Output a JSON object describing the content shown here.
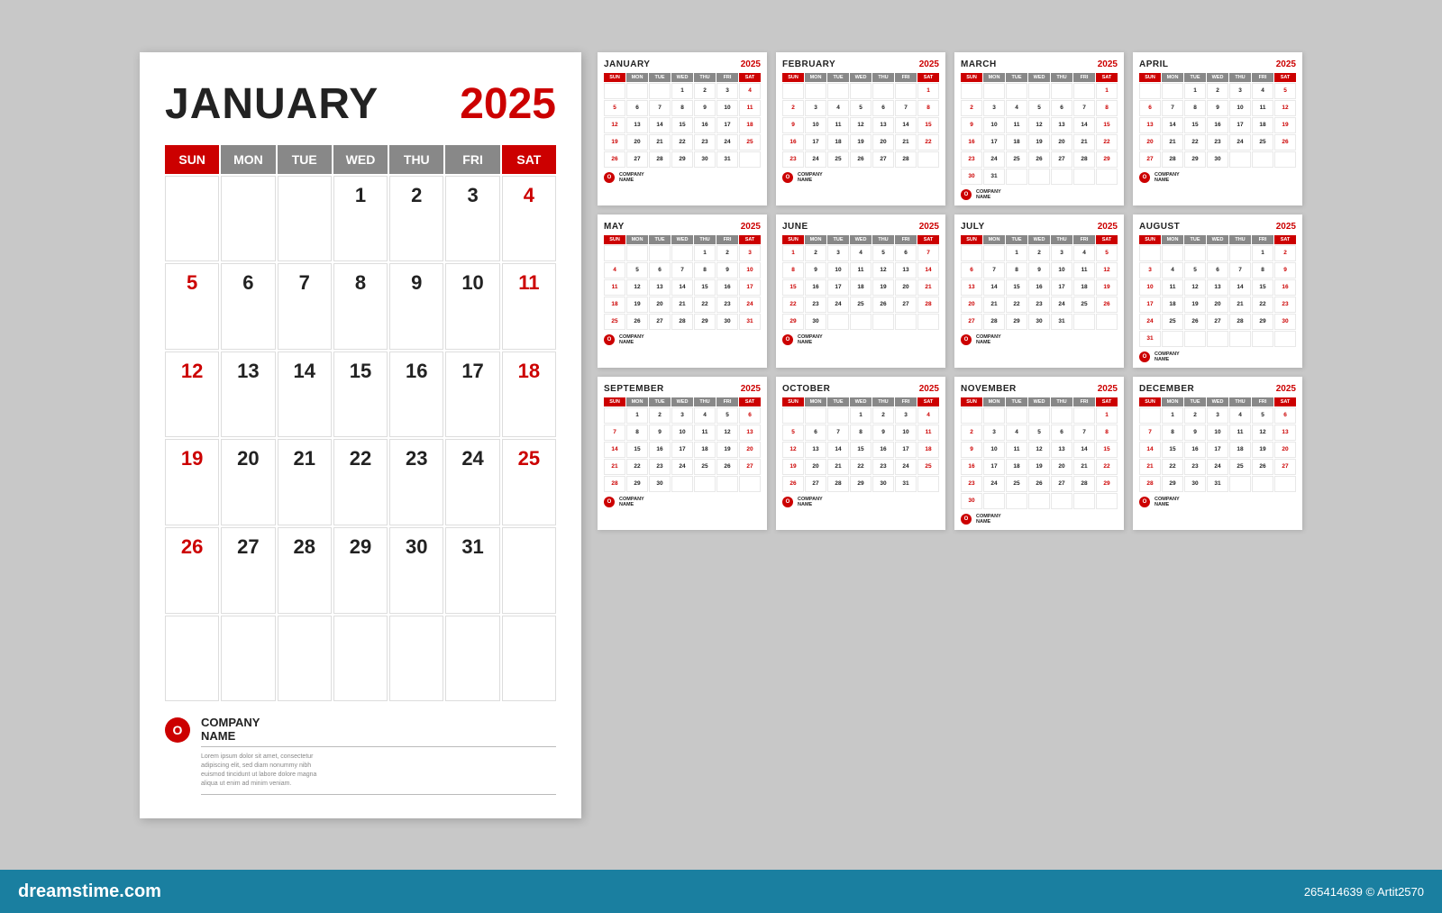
{
  "background": "#c8c8c8",
  "dreamstime": {
    "logo": "dreamstime.com",
    "info": "265414639 © Artit2570"
  },
  "large_calendar": {
    "month": "JANUARY",
    "year": "2025",
    "days_header": [
      "SUN",
      "MON",
      "TUE",
      "WED",
      "THU",
      "FRI",
      "SAT"
    ],
    "company": {
      "name": "COMPANY\nNAME",
      "icon": "O",
      "lorem": "Lorem ipsum dolor sit amet, consectetur adipiscing elit, sed diam nonummy nibh euismod tincidunt ut labore dolore magna aliqua ut enim ad minim veniam."
    },
    "weeks": [
      [
        null,
        null,
        null,
        1,
        2,
        3,
        4
      ],
      [
        5,
        6,
        7,
        8,
        9,
        10,
        11
      ],
      [
        12,
        13,
        14,
        15,
        16,
        17,
        18
      ],
      [
        19,
        20,
        21,
        22,
        23,
        24,
        25
      ],
      [
        26,
        27,
        28,
        29,
        30,
        31,
        null
      ],
      [
        null,
        null,
        null,
        null,
        null,
        null,
        null
      ]
    ]
  },
  "small_calendars": [
    {
      "month": "JANUARY",
      "year": "2025",
      "weeks": [
        [
          null,
          null,
          null,
          1,
          2,
          3,
          4
        ],
        [
          5,
          6,
          7,
          8,
          9,
          10,
          11
        ],
        [
          12,
          13,
          14,
          15,
          16,
          17,
          18
        ],
        [
          19,
          20,
          21,
          22,
          23,
          24,
          25
        ],
        [
          26,
          27,
          28,
          29,
          30,
          31,
          null
        ]
      ]
    },
    {
      "month": "FEBRUARY",
      "year": "2025",
      "weeks": [
        [
          null,
          null,
          null,
          null,
          null,
          null,
          1
        ],
        [
          2,
          3,
          4,
          5,
          6,
          7,
          8
        ],
        [
          9,
          10,
          11,
          12,
          13,
          14,
          15
        ],
        [
          16,
          17,
          18,
          19,
          20,
          21,
          22
        ],
        [
          23,
          24,
          25,
          26,
          27,
          28,
          null
        ]
      ]
    },
    {
      "month": "MARCH",
      "year": "2025",
      "weeks": [
        [
          null,
          null,
          null,
          null,
          null,
          null,
          1
        ],
        [
          2,
          3,
          4,
          5,
          6,
          7,
          8
        ],
        [
          9,
          10,
          11,
          12,
          13,
          14,
          15
        ],
        [
          16,
          17,
          18,
          19,
          20,
          21,
          22
        ],
        [
          23,
          24,
          25,
          26,
          27,
          28,
          29
        ],
        [
          30,
          31,
          null,
          null,
          null,
          null,
          null
        ]
      ]
    },
    {
      "month": "APRIL",
      "year": "2025",
      "weeks": [
        [
          null,
          null,
          1,
          2,
          3,
          4,
          5
        ],
        [
          6,
          7,
          8,
          9,
          10,
          11,
          12
        ],
        [
          13,
          14,
          15,
          16,
          17,
          18,
          19
        ],
        [
          20,
          21,
          22,
          23,
          24,
          25,
          26
        ],
        [
          27,
          28,
          29,
          30,
          null,
          null,
          null
        ]
      ]
    },
    {
      "month": "MAY",
      "year": "2025",
      "weeks": [
        [
          null,
          null,
          null,
          null,
          1,
          2,
          3
        ],
        [
          4,
          5,
          6,
          7,
          8,
          9,
          10
        ],
        [
          11,
          12,
          13,
          14,
          15,
          16,
          17
        ],
        [
          18,
          19,
          20,
          21,
          22,
          23,
          24
        ],
        [
          25,
          26,
          27,
          28,
          29,
          30,
          31
        ]
      ]
    },
    {
      "month": "JUNE",
      "year": "2025",
      "weeks": [
        [
          1,
          2,
          3,
          4,
          5,
          6,
          7
        ],
        [
          8,
          9,
          10,
          11,
          12,
          13,
          14
        ],
        [
          15,
          16,
          17,
          18,
          19,
          20,
          21
        ],
        [
          22,
          23,
          24,
          25,
          26,
          27,
          28
        ],
        [
          29,
          30,
          null,
          null,
          null,
          null,
          null
        ]
      ]
    },
    {
      "month": "JULY",
      "year": "2025",
      "weeks": [
        [
          null,
          null,
          1,
          2,
          3,
          4,
          5
        ],
        [
          6,
          7,
          8,
          9,
          10,
          11,
          12
        ],
        [
          13,
          14,
          15,
          16,
          17,
          18,
          19
        ],
        [
          20,
          21,
          22,
          23,
          24,
          25,
          26
        ],
        [
          27,
          28,
          29,
          30,
          31,
          null,
          null
        ]
      ]
    },
    {
      "month": "AUGUST",
      "year": "2025",
      "weeks": [
        [
          null,
          null,
          null,
          null,
          null,
          1,
          2
        ],
        [
          3,
          4,
          5,
          6,
          7,
          8,
          9
        ],
        [
          10,
          11,
          12,
          13,
          14,
          15,
          16
        ],
        [
          17,
          18,
          19,
          20,
          21,
          22,
          23
        ],
        [
          24,
          25,
          26,
          27,
          28,
          29,
          30
        ],
        [
          31,
          null,
          null,
          null,
          null,
          null,
          null
        ]
      ]
    },
    {
      "month": "SEPTEMBER",
      "year": "2025",
      "weeks": [
        [
          null,
          1,
          2,
          3,
          4,
          5,
          6
        ],
        [
          7,
          8,
          9,
          10,
          11,
          12,
          13
        ],
        [
          14,
          15,
          16,
          17,
          18,
          19,
          20
        ],
        [
          21,
          22,
          23,
          24,
          25,
          26,
          27
        ],
        [
          28,
          29,
          30,
          null,
          null,
          null,
          null
        ]
      ]
    },
    {
      "month": "OCTOBER",
      "year": "2025",
      "weeks": [
        [
          null,
          null,
          null,
          1,
          2,
          3,
          4
        ],
        [
          5,
          6,
          7,
          8,
          9,
          10,
          11
        ],
        [
          12,
          13,
          14,
          15,
          16,
          17,
          18
        ],
        [
          19,
          20,
          21,
          22,
          23,
          24,
          25
        ],
        [
          26,
          27,
          28,
          29,
          30,
          31,
          null
        ]
      ]
    },
    {
      "month": "NOVEMBER",
      "year": "2025",
      "weeks": [
        [
          null,
          null,
          null,
          null,
          null,
          null,
          1
        ],
        [
          2,
          3,
          4,
          5,
          6,
          7,
          8
        ],
        [
          9,
          10,
          11,
          12,
          13,
          14,
          15
        ],
        [
          16,
          17,
          18,
          19,
          20,
          21,
          22
        ],
        [
          23,
          24,
          25,
          26,
          27,
          28,
          29
        ],
        [
          30,
          null,
          null,
          null,
          null,
          null,
          null
        ]
      ]
    },
    {
      "month": "DECEMBER",
      "year": "2025",
      "weeks": [
        [
          null,
          1,
          2,
          3,
          4,
          5,
          6
        ],
        [
          7,
          8,
          9,
          10,
          11,
          12,
          13
        ],
        [
          14,
          15,
          16,
          17,
          18,
          19,
          20
        ],
        [
          21,
          22,
          23,
          24,
          25,
          26,
          27
        ],
        [
          28,
          29,
          30,
          31,
          null,
          null,
          null
        ]
      ]
    }
  ]
}
